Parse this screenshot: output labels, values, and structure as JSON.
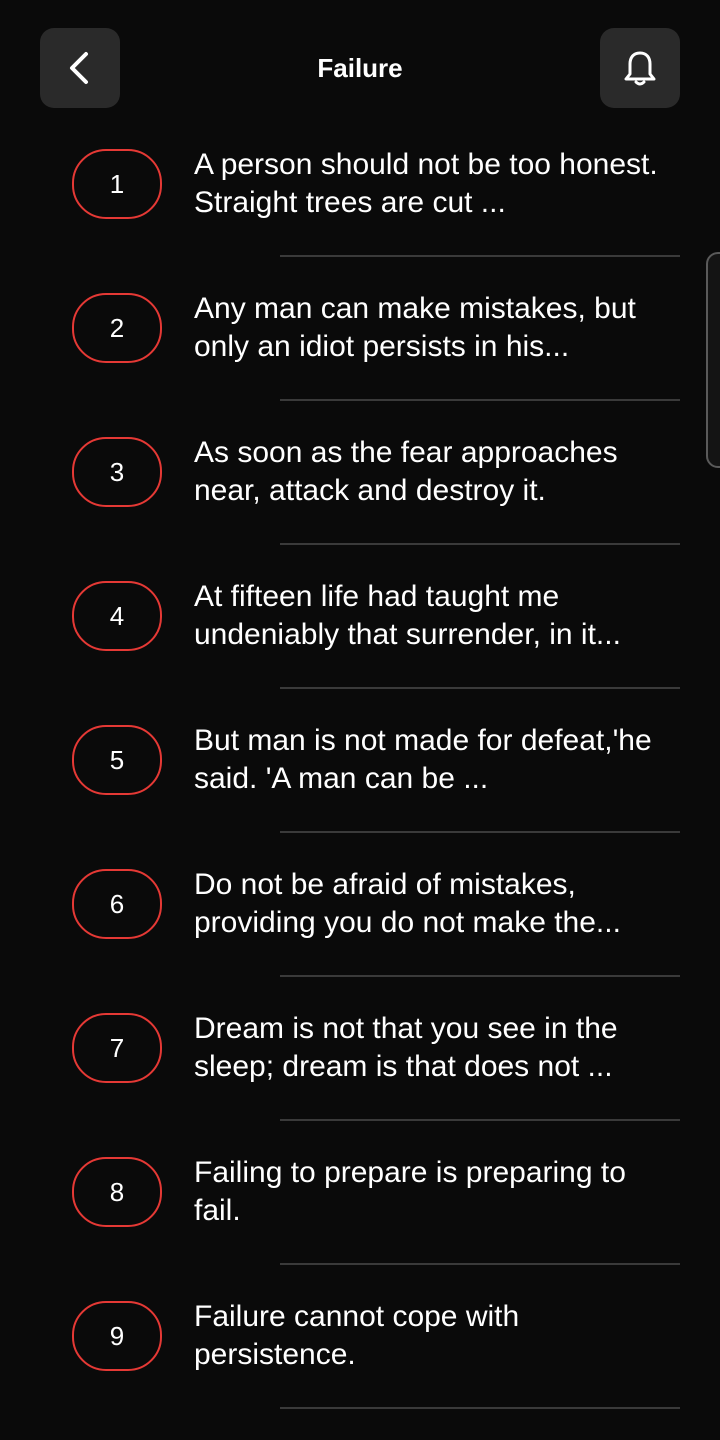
{
  "header": {
    "title": "Failure",
    "back_icon": "chevron-left-icon",
    "bell_icon": "bell-icon"
  },
  "colors": {
    "accent": "#e53935",
    "background": "#0a0a0a",
    "button_bg": "#2a2a2a"
  },
  "quotes": [
    {
      "number": "1",
      "text": "A person should not be too honest. Straight trees are cut ..."
    },
    {
      "number": "2",
      "text": "Any man can make mistakes, but only an idiot persists in his..."
    },
    {
      "number": "3",
      "text": "As soon as the fear approaches near, attack and destroy it."
    },
    {
      "number": "4",
      "text": "At fifteen life had taught me undeniably that surrender, in it..."
    },
    {
      "number": "5",
      "text": "But man is not made for defeat,'he said. 'A man can be ..."
    },
    {
      "number": "6",
      "text": "Do not be afraid of mistakes, providing you do not make the..."
    },
    {
      "number": "7",
      "text": "Dream is not that you see in the sleep; dream is that does not ..."
    },
    {
      "number": "8",
      "text": "Failing to prepare is preparing to fail."
    },
    {
      "number": "9",
      "text": "Failure cannot cope with persistence."
    }
  ]
}
